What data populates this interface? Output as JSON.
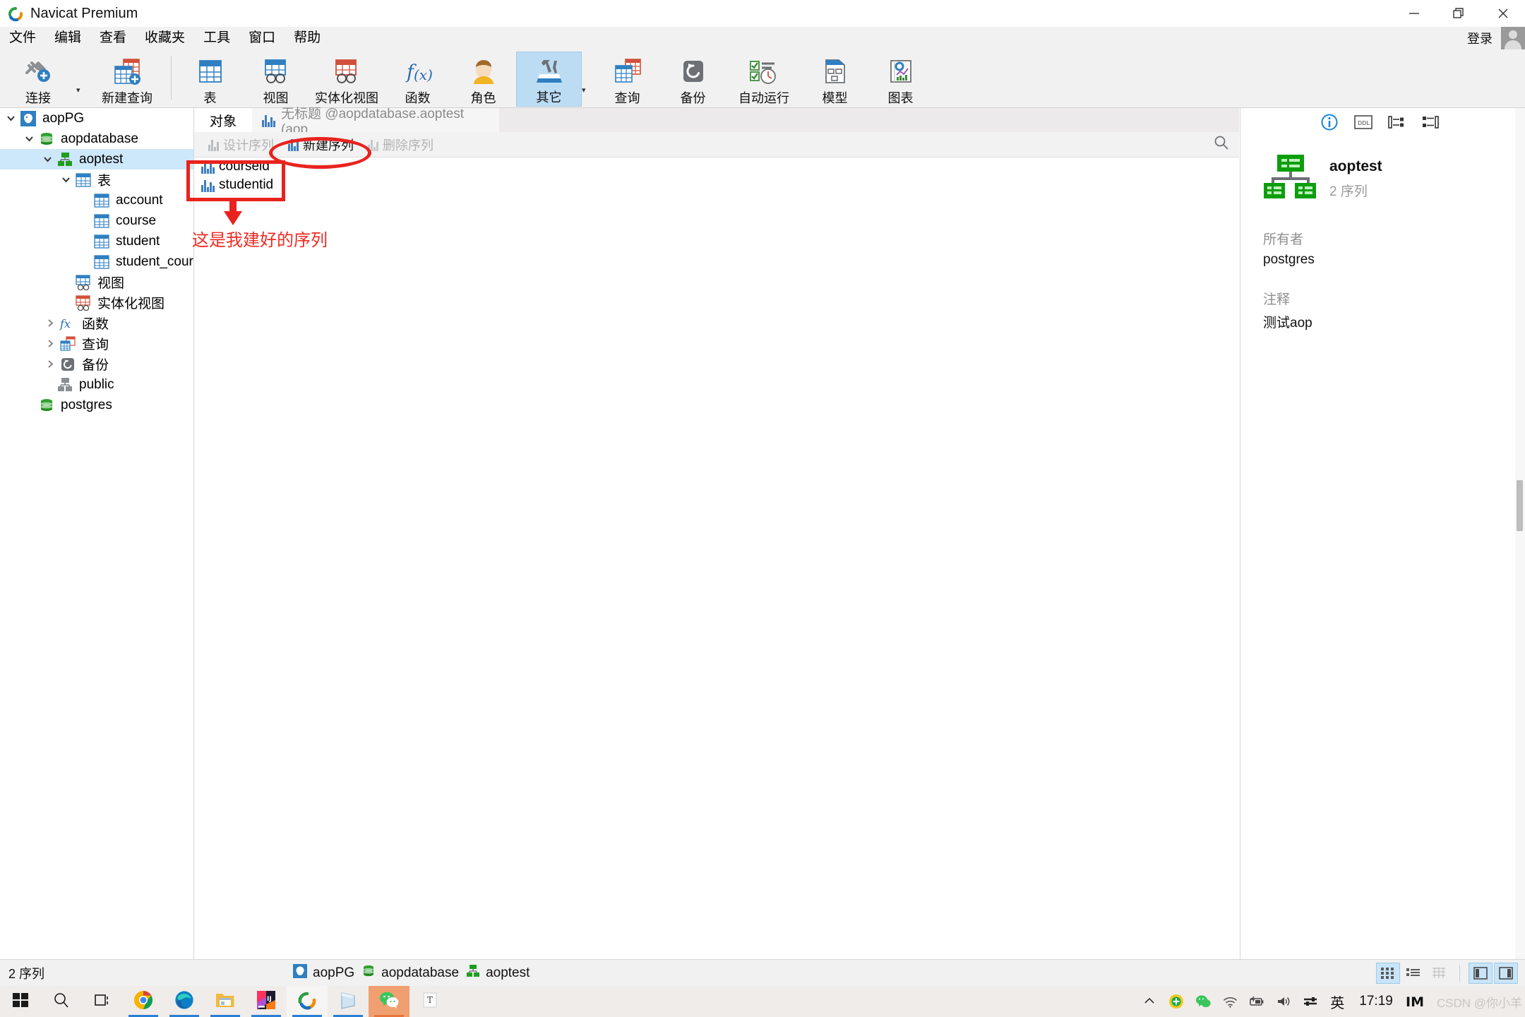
{
  "window": {
    "title": "Navicat Premium",
    "logo_icon": "navicat-logo-icon",
    "minimize_icon": "minimize-icon",
    "maximize_icon": "restore-icon",
    "close_icon": "close-icon"
  },
  "menubar": {
    "items": [
      {
        "label": "文件",
        "name": "menu-file"
      },
      {
        "label": "编辑",
        "name": "menu-edit"
      },
      {
        "label": "查看",
        "name": "menu-view"
      },
      {
        "label": "收藏夹",
        "name": "menu-favorites"
      },
      {
        "label": "工具",
        "name": "menu-tools"
      },
      {
        "label": "窗口",
        "name": "menu-window"
      },
      {
        "label": "帮助",
        "name": "menu-help"
      }
    ],
    "login_label": "登录",
    "avatar_icon": "user-avatar-icon"
  },
  "toolbar": {
    "items": [
      {
        "label": "连接",
        "name": "toolbar-connection",
        "icon": "plug-plus-icon",
        "active": false,
        "caret": true
      },
      {
        "label": "新建查询",
        "name": "toolbar-new-query",
        "icon": "new-query-icon",
        "active": false,
        "caret": false
      },
      {
        "label": "表",
        "name": "toolbar-table",
        "icon": "table-icon",
        "active": false,
        "caret": false
      },
      {
        "label": "视图",
        "name": "toolbar-view",
        "icon": "view-icon",
        "active": false,
        "caret": false
      },
      {
        "label": "实体化视图",
        "name": "toolbar-materialized-view",
        "icon": "materialized-view-icon",
        "active": false,
        "caret": false
      },
      {
        "label": "函数",
        "name": "toolbar-function",
        "icon": "function-fx-icon",
        "active": false,
        "caret": false
      },
      {
        "label": "角色",
        "name": "toolbar-role",
        "icon": "role-user-icon",
        "active": false,
        "caret": false
      },
      {
        "label": "其它",
        "name": "toolbar-others",
        "icon": "tools-wrench-icon",
        "active": true,
        "caret": true
      },
      {
        "label": "查询",
        "name": "toolbar-query",
        "icon": "query-icon",
        "active": false,
        "caret": false
      },
      {
        "label": "备份",
        "name": "toolbar-backup",
        "icon": "backup-restore-icon",
        "active": false,
        "caret": false
      },
      {
        "label": "自动运行",
        "name": "toolbar-automation",
        "icon": "automation-clock-icon",
        "active": false,
        "caret": false
      },
      {
        "label": "模型",
        "name": "toolbar-model",
        "icon": "model-diagram-icon",
        "active": false,
        "caret": false
      },
      {
        "label": "图表",
        "name": "toolbar-chart",
        "icon": "chart-icon",
        "active": false,
        "caret": false
      }
    ]
  },
  "sidebar": {
    "nodes": [
      {
        "label": "aopPG",
        "name": "tree-node-aoppg",
        "icon": "postgresql-elephant-icon",
        "indent": 0,
        "twisty": "down",
        "selected": false
      },
      {
        "label": "aopdatabase",
        "name": "tree-node-aopdatabase",
        "icon": "database-icon",
        "indent": 1,
        "twisty": "down",
        "selected": false
      },
      {
        "label": "aoptest",
        "name": "tree-node-aoptest",
        "icon": "schema-icon",
        "indent": 2,
        "twisty": "down",
        "selected": true
      },
      {
        "label": "表",
        "name": "tree-node-tables",
        "icon": "table-icon",
        "indent": 3,
        "twisty": "down",
        "selected": false
      },
      {
        "label": "account",
        "name": "tree-node-account",
        "icon": "table-icon",
        "indent": 4,
        "twisty": "none",
        "selected": false
      },
      {
        "label": "course",
        "name": "tree-node-course",
        "icon": "table-icon",
        "indent": 4,
        "twisty": "none",
        "selected": false
      },
      {
        "label": "student",
        "name": "tree-node-student",
        "icon": "table-icon",
        "indent": 4,
        "twisty": "none",
        "selected": false
      },
      {
        "label": "student_course",
        "name": "tree-node-student-course",
        "icon": "table-icon",
        "indent": 4,
        "twisty": "none",
        "selected": false
      },
      {
        "label": "视图",
        "name": "tree-node-views",
        "icon": "view-icon",
        "indent": 3,
        "twisty": "none",
        "selected": false
      },
      {
        "label": "实体化视图",
        "name": "tree-node-materialized-views",
        "icon": "materialized-view-icon",
        "indent": 3,
        "twisty": "none",
        "selected": false
      },
      {
        "label": "函数",
        "name": "tree-node-functions",
        "icon": "function-fx-icon",
        "indent": 3,
        "twisty": "right",
        "selected": false
      },
      {
        "label": "查询",
        "name": "tree-node-queries",
        "icon": "query-icon",
        "indent": 3,
        "twisty": "right",
        "selected": false
      },
      {
        "label": "备份",
        "name": "tree-node-backups",
        "icon": "backup-restore-icon",
        "indent": 3,
        "twisty": "right",
        "selected": false
      },
      {
        "label": "public",
        "name": "tree-node-public",
        "icon": "schema-icon",
        "indent": 2,
        "twisty": "none",
        "selected": false
      },
      {
        "label": "postgres",
        "name": "tree-node-postgres",
        "icon": "database-icon",
        "indent": 1,
        "twisty": "none",
        "selected": false
      }
    ]
  },
  "main": {
    "tabs": [
      {
        "label": "对象",
        "name": "tab-objects",
        "active": true,
        "icon": null
      },
      {
        "label": "无标题 @aopdatabase.aoptest (aop...",
        "name": "tab-untitled-query",
        "active": false,
        "icon": "sequence-icon"
      }
    ],
    "objbar": [
      {
        "label": "设计序列",
        "name": "design-sequence-button",
        "icon": "design-sequence-icon",
        "enabled": false
      },
      {
        "label": "新建序列",
        "name": "new-sequence-button",
        "icon": "new-sequence-icon",
        "enabled": true
      },
      {
        "label": "删除序列",
        "name": "delete-sequence-button",
        "icon": "delete-sequence-icon",
        "enabled": false
      }
    ],
    "search_icon": "search-icon",
    "objects": [
      {
        "label": "courseid",
        "name": "object-row-courseid",
        "icon": "sequence-icon"
      },
      {
        "label": "studentid",
        "name": "object-row-studentid",
        "icon": "sequence-icon"
      }
    ]
  },
  "info_panel": {
    "icons": [
      {
        "name": "info-tab-icon",
        "glyph": "info"
      },
      {
        "name": "ddl-tab-icon",
        "glyph": "DDL"
      },
      {
        "name": "relations-tab-icon",
        "glyph": "rel"
      },
      {
        "name": "preview-tab-icon",
        "glyph": "prev"
      }
    ],
    "object_icon": "schema-icon",
    "title": "aoptest",
    "subtitle": "2 序列",
    "fields": [
      {
        "label": "所有者",
        "value": "postgres",
        "name": "info-owner"
      },
      {
        "label": "注释",
        "value": "测试aop",
        "name": "info-comment"
      }
    ]
  },
  "statusbar": {
    "count": "2 序列",
    "breadcrumbs": [
      {
        "label": "aopPG",
        "icon": "postgresql-elephant-icon",
        "name": "status-crumb-aoppg"
      },
      {
        "label": "aopdatabase",
        "icon": "database-icon",
        "name": "status-crumb-aopdatabase"
      },
      {
        "label": "aoptest",
        "icon": "schema-icon",
        "name": "status-crumb-aoptest"
      }
    ],
    "view_buttons": [
      {
        "name": "view-grid-button",
        "icon": "grid-view-icon",
        "active": true
      },
      {
        "name": "view-list-button",
        "icon": "list-view-icon",
        "active": false
      },
      {
        "name": "view-detail-button",
        "icon": "detail-view-icon",
        "active": false
      },
      {
        "name": "panel-left-button",
        "icon": "left-panel-icon",
        "active": true
      },
      {
        "name": "panel-right-button",
        "icon": "right-panel-icon",
        "active": true
      }
    ]
  },
  "annotations": [
    {
      "name": "annotation-sequence-list-box",
      "type": "box"
    },
    {
      "name": "annotation-new-sequence-ellipse",
      "type": "ellipse"
    },
    {
      "name": "annotation-arrow-down",
      "type": "arrow"
    },
    {
      "name": "annotation-note",
      "type": "text",
      "text": "这是我建好的序列",
      "color": "#ee2b24"
    }
  ],
  "taskbar": {
    "items": [
      {
        "name": "taskbar-start-button",
        "icon": "windows-start-icon"
      },
      {
        "name": "taskbar-search-button",
        "icon": "search-icon"
      },
      {
        "name": "taskbar-taskview-button",
        "icon": "task-view-icon"
      },
      {
        "name": "taskbar-chrome",
        "icon": "chrome-icon"
      },
      {
        "name": "taskbar-edge",
        "icon": "edge-icon"
      },
      {
        "name": "taskbar-explorer",
        "icon": "file-explorer-icon"
      },
      {
        "name": "taskbar-intellij",
        "icon": "intellij-idea-icon"
      },
      {
        "name": "taskbar-navicat",
        "icon": "navicat-logo-icon"
      },
      {
        "name": "taskbar-notebook",
        "icon": "notebook-icon"
      },
      {
        "name": "taskbar-wechat",
        "icon": "wechat-icon"
      },
      {
        "name": "taskbar-typora",
        "icon": "typora-icon"
      }
    ],
    "tray": [
      {
        "name": "tray-expand-icon",
        "icon": "chevron-up-icon"
      },
      {
        "name": "tray-security-icon",
        "icon": "360-security-icon"
      },
      {
        "name": "tray-wechat-icon",
        "icon": "wechat-icon"
      },
      {
        "name": "tray-network-icon",
        "icon": "wifi-icon"
      },
      {
        "name": "tray-battery-icon",
        "icon": "battery-charging-icon"
      },
      {
        "name": "tray-volume-icon",
        "icon": "volume-icon"
      },
      {
        "name": "tray-settings-icon",
        "icon": "sliders-icon"
      }
    ],
    "ime_label": "英",
    "clock": "17:19",
    "watermark": "CSDN @你小羊"
  }
}
